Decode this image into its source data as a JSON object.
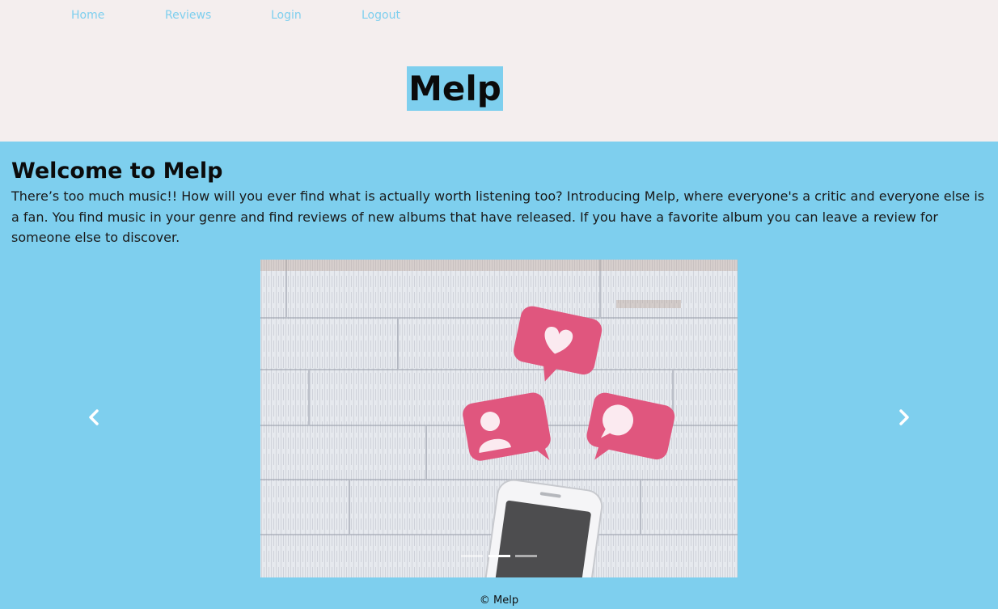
{
  "nav": {
    "items": [
      {
        "label": "Home"
      },
      {
        "label": "Reviews"
      },
      {
        "label": "Login"
      },
      {
        "label": "Logout"
      }
    ]
  },
  "brand": {
    "title": "Melp"
  },
  "welcome": {
    "title": "Welcome to Melp",
    "text": "There’s too much music!! How will you ever find what is actually worth listening too? Introducing Melp, where everyone's a critic and everyone else is a fan. You find music in your genre and find reviews of new albums that have released. If you have a favorite album you can leave a review for someone else to discover."
  },
  "carousel": {
    "active_index": 1,
    "indicator_count": 3,
    "prev_icon": "chevron-left-icon",
    "next_icon": "chevron-right-icon"
  },
  "footer": {
    "text": "© Melp"
  },
  "colors": {
    "accent": "#7ecfee",
    "header_bg": "#f4eeee",
    "bubble": "#e0567e"
  }
}
